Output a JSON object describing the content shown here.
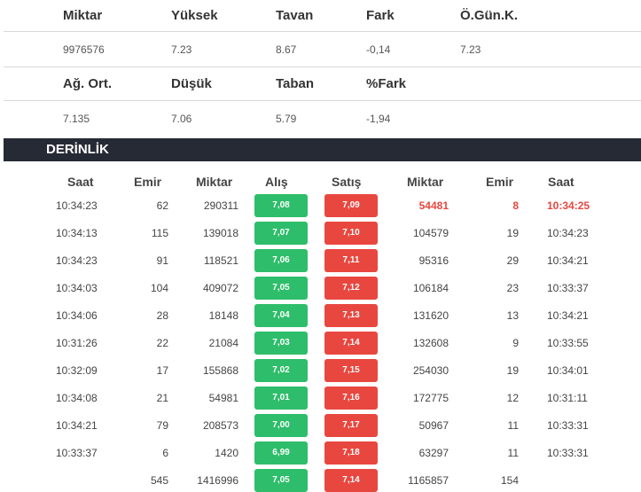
{
  "summary": {
    "row1_headers": [
      "Miktar",
      "Yüksek",
      "Tavan",
      "Fark",
      "Ö.Gün.K."
    ],
    "row1_values": [
      "9976576",
      "7.23",
      "8.67",
      "-0,14",
      "7.23"
    ],
    "row2_headers": [
      "Ağ. Ort.",
      "Düşük",
      "Taban",
      "%Fark"
    ],
    "row2_values": [
      "7.135",
      "7.06",
      "5.79",
      "-1,94"
    ]
  },
  "depth": {
    "title": "DERİNLİK",
    "columns": [
      "Saat",
      "Emir",
      "Miktar",
      "Alış",
      "Satış",
      "Miktar",
      "Emir",
      "Saat"
    ],
    "rows": [
      {
        "bid_time": "10:34:23",
        "bid_orders": "62",
        "bid_qty": "290311",
        "bid_price": "7,08",
        "ask_price": "7,09",
        "ask_qty": "54481",
        "ask_orders": "8",
        "ask_time": "10:34:25"
      },
      {
        "bid_time": "10:34:13",
        "bid_orders": "115",
        "bid_qty": "139018",
        "bid_price": "7,07",
        "ask_price": "7,10",
        "ask_qty": "104579",
        "ask_orders": "19",
        "ask_time": "10:34:23"
      },
      {
        "bid_time": "10:34:23",
        "bid_orders": "91",
        "bid_qty": "118521",
        "bid_price": "7,06",
        "ask_price": "7,11",
        "ask_qty": "95316",
        "ask_orders": "29",
        "ask_time": "10:34:21"
      },
      {
        "bid_time": "10:34:03",
        "bid_orders": "104",
        "bid_qty": "409072",
        "bid_price": "7,05",
        "ask_price": "7,12",
        "ask_qty": "106184",
        "ask_orders": "23",
        "ask_time": "10:33:37"
      },
      {
        "bid_time": "10:34:06",
        "bid_orders": "28",
        "bid_qty": "18148",
        "bid_price": "7,04",
        "ask_price": "7,13",
        "ask_qty": "131620",
        "ask_orders": "13",
        "ask_time": "10:34:21"
      },
      {
        "bid_time": "10:31:26",
        "bid_orders": "22",
        "bid_qty": "21084",
        "bid_price": "7,03",
        "ask_price": "7,14",
        "ask_qty": "132608",
        "ask_orders": "9",
        "ask_time": "10:33:55"
      },
      {
        "bid_time": "10:32:09",
        "bid_orders": "17",
        "bid_qty": "155868",
        "bid_price": "7,02",
        "ask_price": "7,15",
        "ask_qty": "254030",
        "ask_orders": "19",
        "ask_time": "10:34:01"
      },
      {
        "bid_time": "10:34:08",
        "bid_orders": "21",
        "bid_qty": "54981",
        "bid_price": "7,01",
        "ask_price": "7,16",
        "ask_qty": "172775",
        "ask_orders": "12",
        "ask_time": "10:31:11"
      },
      {
        "bid_time": "10:34:21",
        "bid_orders": "79",
        "bid_qty": "208573",
        "bid_price": "7,00",
        "ask_price": "7,17",
        "ask_qty": "50967",
        "ask_orders": "11",
        "ask_time": "10:33:31"
      },
      {
        "bid_time": "10:33:37",
        "bid_orders": "6",
        "bid_qty": "1420",
        "bid_price": "6,99",
        "ask_price": "7,18",
        "ask_qty": "63297",
        "ask_orders": "11",
        "ask_time": "10:33:31"
      }
    ],
    "totals": {
      "bid_orders": "545",
      "bid_qty": "1416996",
      "bid_price": "7,05",
      "ask_price": "7,14",
      "ask_qty": "1165857",
      "ask_orders": "154"
    }
  },
  "colors": {
    "buy": "#2ebd6a",
    "sell": "#e8473f",
    "banner": "#262a35"
  }
}
